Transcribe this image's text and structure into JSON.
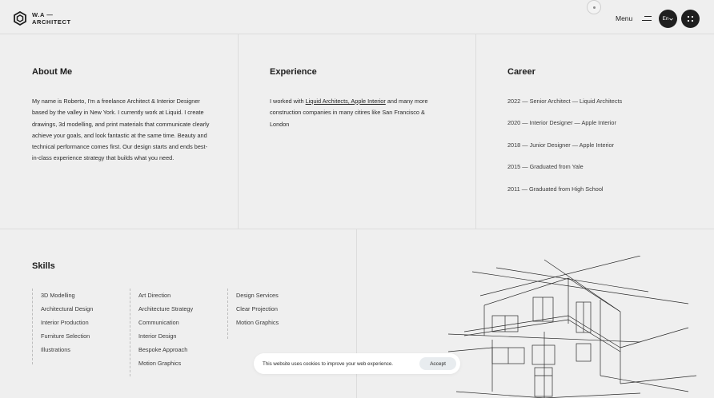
{
  "header": {
    "logo_line1": "W.A —",
    "logo_line2": "ARCHITECT",
    "menu_label": "Menu",
    "lang_label": "En"
  },
  "about": {
    "title": "About Me",
    "text": "My name is Roberto, I'm a freelance Architect & Interior Designer based by the valley in New York. I currently work at Liquid. I create drawings, 3d modelling, and print materials that communicate clearly achieve your goals, and look fantastic at the same time. Beauty and technical performance comes first. Our design starts and ends best-in-class experience strategy that builds what you need."
  },
  "experience": {
    "title": "Experience",
    "text_before": "I worked with ",
    "link_text": "Liquid Architects, Apple Interior",
    "text_after": " and many more construction companies in many citires like San Francisco & London"
  },
  "career": {
    "title": "Career",
    "items": [
      "2022 — Senior Architect — Liquid Architects",
      "2020 — Interior Designer — Apple Interior",
      "2018 — Junior Designer — Apple Interior",
      "2015 — Graduated from Yale",
      "2011 — Graduated from High School"
    ]
  },
  "skills": {
    "title": "Skills",
    "col1": [
      "3D Modelling",
      "Architectural Design",
      "Interior Production",
      "Furniture Selection",
      "Illustrations"
    ],
    "col2": [
      "Art Direction",
      "Architecture Strategy",
      "Communication",
      "Interior Design",
      "Bespoke Approach",
      "Motion Graphics"
    ],
    "col3": [
      "Design Services",
      "Clear Projection",
      "Motion Graphics"
    ]
  },
  "cookie": {
    "text": "This website uses cookies to improve your web experience.",
    "accept_label": "Accept"
  },
  "colors": {
    "background": "#efefef",
    "dark": "#1f1f1f",
    "divider": "#dcdcdc"
  }
}
